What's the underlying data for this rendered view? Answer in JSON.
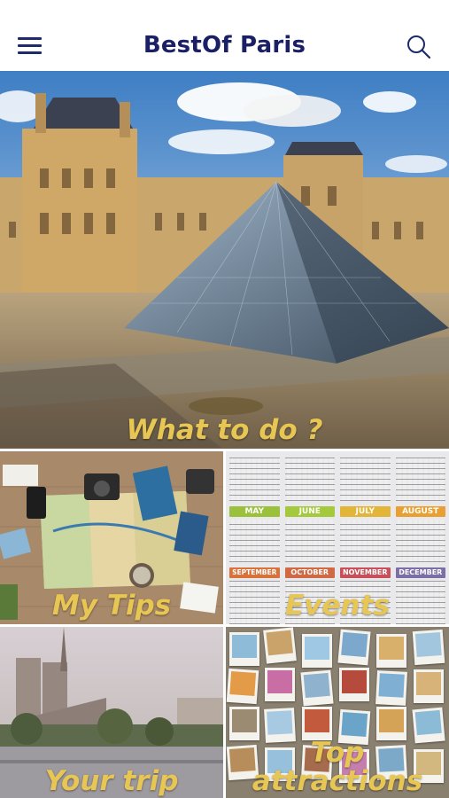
{
  "header": {
    "menu_icon": "hamburger-menu-icon",
    "title": "BestOf Paris",
    "search_icon": "search-icon",
    "title_color": "#1a1f66"
  },
  "tiles": {
    "what_to_do": {
      "label": "What to do ?"
    },
    "my_tips": {
      "label": "My Tips"
    },
    "events": {
      "label": "Events",
      "months": [
        {
          "name": "",
          "color": "#8a8a8a"
        },
        {
          "name": "",
          "color": "#8a8a8a"
        },
        {
          "name": "",
          "color": "#8a8a8a"
        },
        {
          "name": "",
          "color": "#8a8a8a"
        },
        {
          "name": "MAY",
          "color": "#9bc13c"
        },
        {
          "name": "JUNE",
          "color": "#a4c93d"
        },
        {
          "name": "JULY",
          "color": "#e2b437"
        },
        {
          "name": "AUGUST",
          "color": "#e8a032"
        },
        {
          "name": "SEPTEMBER",
          "color": "#d9723a"
        },
        {
          "name": "OCTOBER",
          "color": "#cf6a44"
        },
        {
          "name": "NOVEMBER",
          "color": "#c8505a"
        },
        {
          "name": "DECEMBER",
          "color": "#7c6fa8"
        }
      ]
    },
    "your_trip": {
      "label": "Your trip"
    },
    "top_attractions": {
      "label_line1": "Top",
      "label_line2": "attractions"
    }
  },
  "label_color": "#e8c653"
}
